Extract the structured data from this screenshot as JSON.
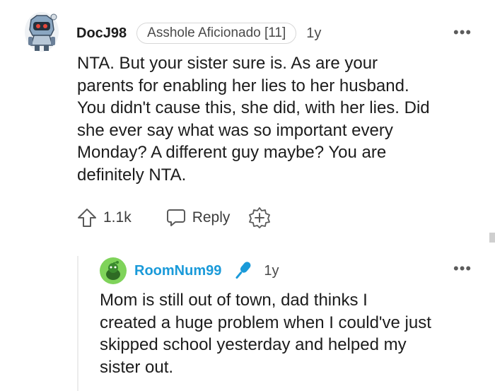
{
  "comment": {
    "username": "DocJ98",
    "flair": "Asshole Aficionado [11]",
    "age": "1y",
    "more": "•••",
    "body": "NTA. But your sister sure is. As are your\nparents for enabling her lies to her husband.\nYou didn't cause this, she did, with her lies. Did\nshe ever say what was so important every\nMonday? A different guy maybe? You are\ndefinitely NTA.",
    "upvotes": "1.1k",
    "reply_label": "Reply",
    "icons": {
      "avatar": "avatar-icon",
      "upvote": "upvote-arrow-icon",
      "reply": "reply-bubble-icon",
      "award": "award-plus-icon",
      "more": "more-dots-icon"
    }
  },
  "reply": {
    "username": "RoomNum99",
    "age": "1y",
    "more": "•••",
    "body": "Mom is still out of town, dad thinks I\ncreated a huge problem when I could've just\nskipped school yesterday and helped my\nsister out.",
    "icons": {
      "avatar": "avatar-icon",
      "op_badge": "microphone-icon",
      "more": "more-dots-icon"
    }
  },
  "colors": {
    "text": "#1c1c1c",
    "muted": "#4a4a4a",
    "reply_username": "#1a9ad9",
    "flair_border": "#d7d7d7",
    "thread_line": "#ececec"
  }
}
